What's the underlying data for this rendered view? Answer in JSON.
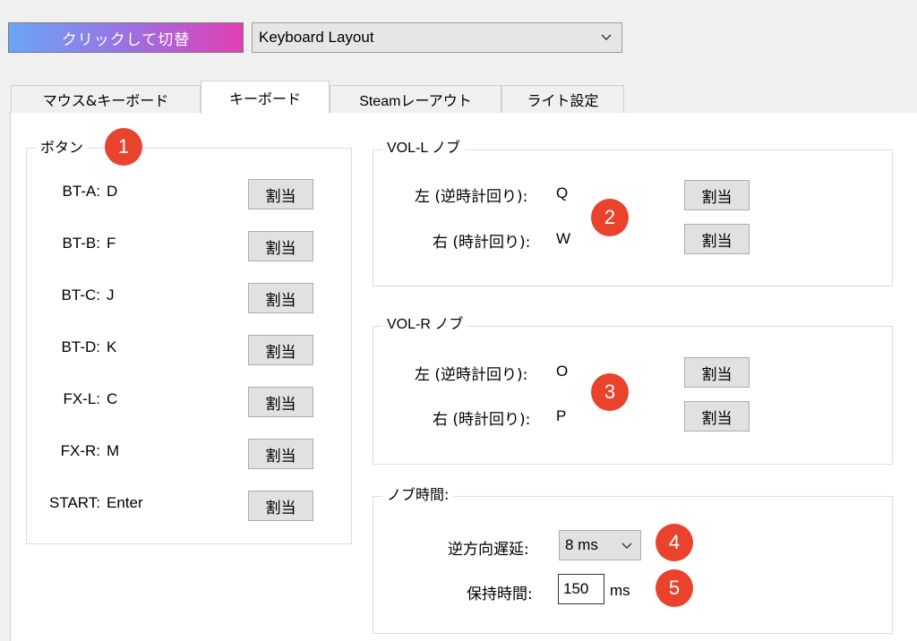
{
  "toolbar": {
    "toggle_label": "クリックして切替",
    "layout_select_value": "Keyboard Layout"
  },
  "tabs": [
    {
      "label": "マウス&キーボード",
      "active": false
    },
    {
      "label": "キーボード",
      "active": true
    },
    {
      "label": "Steamレーアウト",
      "active": false
    },
    {
      "label": "ライト設定",
      "active": false
    }
  ],
  "buttons_group": {
    "title": "ボタン",
    "assign_label": "割当",
    "rows": [
      {
        "name": "BT-A:",
        "key": "D"
      },
      {
        "name": "BT-B:",
        "key": "F"
      },
      {
        "name": "BT-C:",
        "key": "J"
      },
      {
        "name": "BT-D:",
        "key": "K"
      },
      {
        "name": "FX-L:",
        "key": "C"
      },
      {
        "name": "FX-R:",
        "key": "M"
      },
      {
        "name": "START:",
        "key": "Enter"
      }
    ]
  },
  "vol_l": {
    "title": "VOL-L ノブ",
    "left_label": "左 (逆時計回り):",
    "left_key": "Q",
    "right_label": "右 (時計回り):",
    "right_key": "W",
    "assign_label": "割当"
  },
  "vol_r": {
    "title": "VOL-R ノブ",
    "left_label": "左 (逆時計回り):",
    "left_key": "O",
    "right_label": "右 (時計回り):",
    "right_key": "P",
    "assign_label": "割当"
  },
  "knob_time": {
    "title": "ノブ時間:",
    "delay_label": "逆方向遅延:",
    "delay_value": "8 ms",
    "hold_label": "保持時間:",
    "hold_value": "150",
    "hold_unit": "ms"
  },
  "badges": [
    "1",
    "2",
    "3",
    "4",
    "5"
  ],
  "colors": {
    "badge": "#e9432e",
    "toggle_gradient_start": "#6aa6f5",
    "toggle_gradient_end": "#e23fb3"
  }
}
